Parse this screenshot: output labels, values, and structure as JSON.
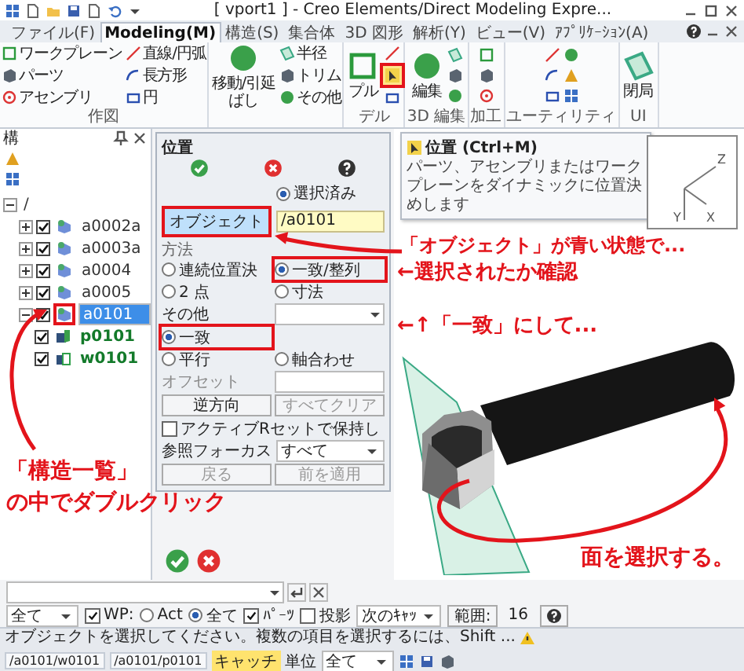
{
  "window": {
    "title": "[ vport1 ] - Creo Elements/Direct Modeling Expre..."
  },
  "tabs": [
    {
      "label": "ファイル(F)",
      "selected": false
    },
    {
      "label": "Modeling(M)",
      "selected": true
    },
    {
      "label": "構造(S)",
      "selected": false
    },
    {
      "label": "集合体",
      "selected": false
    },
    {
      "label": "3D 図形",
      "selected": false
    },
    {
      "label": "解析(Y)",
      "selected": false
    },
    {
      "label": "ビュー(V)",
      "selected": false
    },
    {
      "label": "ｱﾌﾟﾘｹｰｼｮﾝ(A)",
      "selected": false
    }
  ],
  "ribbon": {
    "groups": [
      {
        "label": "作図",
        "columns": [
          {
            "kind": "stack",
            "items": [
              "ワークプレーン",
              "パーツ",
              "アセンブリ"
            ]
          },
          {
            "kind": "stack",
            "items": [
              "直線/円弧",
              "長方形",
              "円"
            ]
          }
        ]
      },
      {
        "columns": [
          {
            "kind": "large",
            "label": "移動/引延ばし"
          },
          {
            "kind": "stack",
            "items": [
              "半径",
              "トリム",
              "その他"
            ]
          }
        ]
      },
      {
        "label": "デル",
        "columns": [
          {
            "kind": "large",
            "label": "プル"
          },
          {
            "kind": "tool",
            "highlighted": true
          }
        ]
      },
      {
        "label": "3D 編集",
        "columns": [
          {
            "kind": "large",
            "label": "編集"
          },
          {
            "kind": "icons"
          }
        ]
      },
      {
        "label": "加工",
        "columns": [
          {
            "kind": "icons"
          }
        ]
      },
      {
        "label": "ユーティリティ",
        "columns": [
          {
            "kind": "icons"
          },
          {
            "kind": "icons"
          }
        ]
      },
      {
        "label": "UI",
        "columns": [
          {
            "kind": "large",
            "label": "閉局"
          }
        ]
      }
    ]
  },
  "structure_panel": {
    "title": "構",
    "tree": [
      {
        "label": "/",
        "expanded": true,
        "children": [
          {
            "label": "a0002a",
            "checked": true,
            "expanded": false,
            "selected": false,
            "highlighted": false,
            "kind": "assembly"
          },
          {
            "label": "a0003a",
            "checked": true,
            "expanded": false,
            "selected": false,
            "highlighted": false,
            "kind": "assembly"
          },
          {
            "label": "a0004",
            "checked": true,
            "expanded": false,
            "selected": false,
            "highlighted": false,
            "kind": "assembly"
          },
          {
            "label": "a0005",
            "checked": true,
            "expanded": false,
            "selected": false,
            "highlighted": false,
            "kind": "assembly"
          },
          {
            "label": "a0101",
            "checked": true,
            "expanded": true,
            "selected": true,
            "highlighted": true,
            "kind": "assembly",
            "children": [
              {
                "label": "p0101",
                "checked": true,
                "selected": false,
                "highlighted": false,
                "kind": "part"
              },
              {
                "label": "w0101",
                "checked": true,
                "selected": false,
                "highlighted": false,
                "kind": "workplane"
              }
            ]
          }
        ]
      }
    ]
  },
  "dialog": {
    "title": "位置",
    "selection": {
      "label": "選択済み",
      "selected": true
    },
    "object_button": {
      "label": "オブジェクト",
      "active": true,
      "highlighted": true
    },
    "object_field": {
      "value": "/a0101"
    },
    "method_label": "方法",
    "methods": [
      {
        "label": "連続位置決",
        "selected": false,
        "highlighted": false
      },
      {
        "label": "一致/整列",
        "selected": true,
        "highlighted": true
      },
      {
        "label": "2 点",
        "selected": false,
        "highlighted": false
      },
      {
        "label": "寸法",
        "selected": false,
        "highlighted": false
      }
    ],
    "other_label": "その他",
    "constraints": [
      {
        "label": "一致",
        "selected": true,
        "highlighted": true
      },
      {
        "label": "平行",
        "selected": false,
        "highlighted": false
      },
      {
        "label": "軸合わせ",
        "selected": false,
        "highlighted": false
      }
    ],
    "offset_label": "オフセット",
    "buttons": [
      {
        "label": "逆方向",
        "disabled": false
      },
      {
        "label": "すべてクリア",
        "disabled": true
      }
    ],
    "keep": {
      "label": "アクティブRセットで保持し",
      "checked": false
    },
    "focus": {
      "label": "参照フォーカス",
      "value": "すべて"
    },
    "footer_buttons": [
      {
        "label": "戻る",
        "disabled": true
      },
      {
        "label": "前を適用",
        "disabled": true
      }
    ]
  },
  "tooltip": {
    "title": "位置 (Ctrl+M)",
    "text": "パーツ、アセンブリまたはワークプレーンをダイナミックに位置決めします"
  },
  "view_axes": [
    "Z",
    "Y",
    "X"
  ],
  "annotations": {
    "structure": [
      "「構造一覧」",
      "の中でダブルクリック"
    ],
    "object": "「オブジェクト」が青い状態で...",
    "confirm": "←選択されたか確認",
    "match": "←↑「一致」にして...",
    "face": "面を選択する。"
  },
  "toolbar": {
    "filter": "全て",
    "wp": {
      "label": "WP:",
      "checked": true
    },
    "scope": [
      {
        "label": "Act",
        "selected": false
      },
      {
        "label": "全て",
        "selected": true
      }
    ],
    "parts": {
      "label": "ﾊﾟｰﾂ",
      "checked": true
    },
    "projection": {
      "label": "投影",
      "checked": false
    },
    "catch": "次のｷｬｯ",
    "range_button": "範囲:",
    "range_value": "16"
  },
  "status_bar": {
    "message": "オブジェクトを選択してください。複数の項目を選択するには、Shift ...",
    "paths": [
      "/a0101/w0101",
      "/a0101/p0101"
    ],
    "catch": "キャッチ",
    "unit_label": "単位",
    "unit": "全て"
  }
}
